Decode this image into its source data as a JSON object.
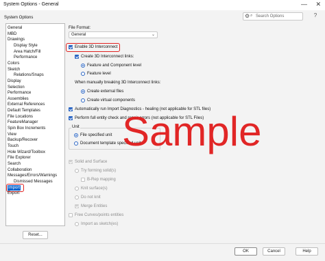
{
  "window": {
    "title": "System Options - General",
    "minimize": "—",
    "close": "✕"
  },
  "search": {
    "placeholder": "Search Options"
  },
  "tab_label": "System Options",
  "sidebar": {
    "items": [
      {
        "label": "General",
        "indent": 0
      },
      {
        "label": "MBD",
        "indent": 0
      },
      {
        "label": "Drawings",
        "indent": 0
      },
      {
        "label": "Display Style",
        "indent": 1
      },
      {
        "label": "Area Hatch/Fill",
        "indent": 1
      },
      {
        "label": "Performance",
        "indent": 1
      },
      {
        "label": "Colors",
        "indent": 0
      },
      {
        "label": "Sketch",
        "indent": 0
      },
      {
        "label": "Relations/Snaps",
        "indent": 1
      },
      {
        "label": "Display",
        "indent": 0
      },
      {
        "label": "Selection",
        "indent": 0
      },
      {
        "label": "Performance",
        "indent": 0
      },
      {
        "label": "Assemblies",
        "indent": 0
      },
      {
        "label": "External References",
        "indent": 0
      },
      {
        "label": "Default Templates",
        "indent": 0
      },
      {
        "label": "File Locations",
        "indent": 0
      },
      {
        "label": "FeatureManager",
        "indent": 0
      },
      {
        "label": "Spin Box Increments",
        "indent": 0
      },
      {
        "label": "View",
        "indent": 0
      },
      {
        "label": "Backup/Recover",
        "indent": 0
      },
      {
        "label": "Touch",
        "indent": 0
      },
      {
        "label": "Hole Wizard/Toolbox",
        "indent": 0
      },
      {
        "label": "File Explorer",
        "indent": 0
      },
      {
        "label": "Search",
        "indent": 0
      },
      {
        "label": "Collaboration",
        "indent": 0
      },
      {
        "label": "Messages/Errors/Warnings",
        "indent": 0
      },
      {
        "label": "Dismissed Messages",
        "indent": 1
      },
      {
        "label": "Import",
        "indent": 0,
        "selected": true
      },
      {
        "label": "Export",
        "indent": 0
      }
    ]
  },
  "reset_label": "Reset...",
  "main": {
    "file_format_label": "File Format:",
    "file_format_value": "General",
    "enable_3d": "Enable 3D Interconnect",
    "create_links": "Create 3D Interconnect links:",
    "feature_component": "Feature and Component level",
    "feature_level": "Feature level",
    "when_breaking": "When manually breaking 3D Interconnect links:",
    "create_external": "Create external files",
    "create_virtual": "Create virtual components",
    "auto_diagnostics": "Automatically run Import Diagnostics - healing (not applicable for STL files)",
    "full_entity": "Perform full entity check and repair errors (not applicable for STL Files)",
    "unit_label": "Unit",
    "file_specified_unit": "File specified unit",
    "document_template": "Document template specified unit",
    "solid_surface": "Solid and Surface",
    "try_forming": "Try forming solid(s)",
    "brep_mapping": "B-Rep mapping",
    "knit_surfaces": "Knit surface(s)",
    "do_not_knit": "Do not knit",
    "merge_entities": "Merge Entities",
    "free_curves": "Free Curves/points entities",
    "import_sketch": "Import as sketch(es)"
  },
  "watermark": "Sample",
  "buttons": {
    "ok": "OK",
    "cancel": "Cancel",
    "help": "Help"
  }
}
